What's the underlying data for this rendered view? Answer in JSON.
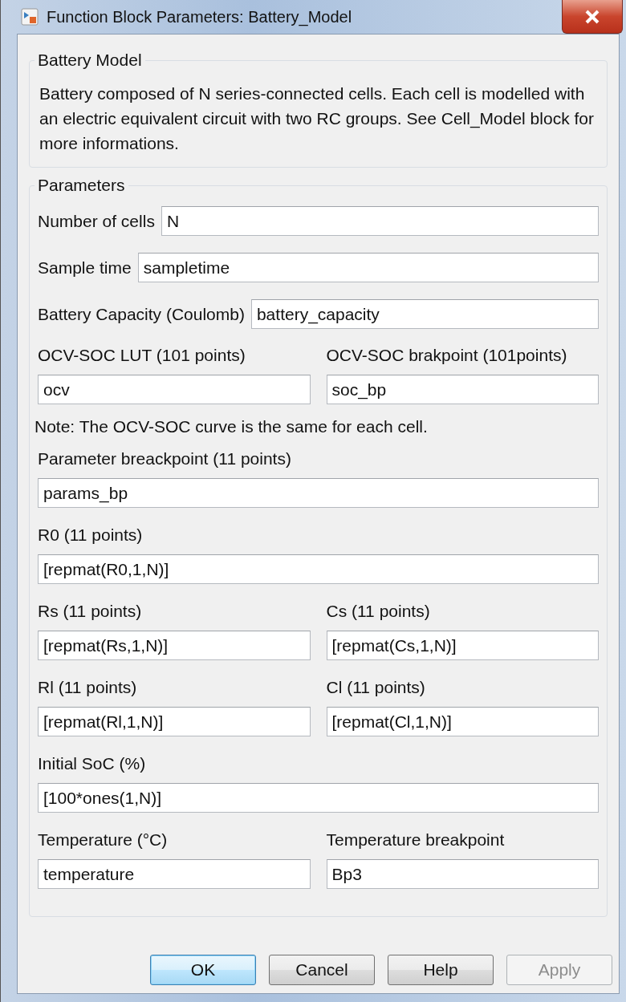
{
  "window": {
    "title": "Function Block Parameters: Battery_Model"
  },
  "description_group": {
    "title": "Battery Model",
    "text": "Battery composed of N series-connected cells. Each cell is modelled with an electric equivalent circuit with two RC groups. See Cell_Model block for more informations."
  },
  "parameters_group": {
    "title": "Parameters",
    "rows": [
      {
        "kind": "inline",
        "fields": [
          {
            "label": "Number of cells",
            "value": "N"
          }
        ]
      },
      {
        "kind": "inline",
        "fields": [
          {
            "label": "Sample time",
            "value": "sampletime"
          }
        ]
      },
      {
        "kind": "inline",
        "fields": [
          {
            "label": "Battery Capacity (Coulomb)",
            "value": "battery_capacity"
          }
        ]
      },
      {
        "kind": "pair",
        "fields": [
          {
            "label": "OCV-SOC LUT (101 points)",
            "value": "ocv"
          },
          {
            "label": "OCV-SOC brakpoint (101points)",
            "value": "soc_bp"
          }
        ]
      },
      {
        "kind": "note",
        "text": "Note: The OCV-SOC curve is the same for each cell."
      },
      {
        "kind": "stacked",
        "fields": [
          {
            "label": "Parameter breackpoint (11 points)",
            "value": "params_bp"
          }
        ]
      },
      {
        "kind": "stacked",
        "fields": [
          {
            "label": "R0 (11 points)",
            "value": "[repmat(R0,1,N)]"
          }
        ]
      },
      {
        "kind": "pair",
        "fields": [
          {
            "label": "Rs (11 points)",
            "value": "[repmat(Rs,1,N)]"
          },
          {
            "label": "Cs (11 points)",
            "value": "[repmat(Cs,1,N)]"
          }
        ]
      },
      {
        "kind": "pair",
        "fields": [
          {
            "label": "Rl (11 points)",
            "value": "[repmat(Rl,1,N)]"
          },
          {
            "label": "Cl (11 points)",
            "value": "[repmat(Cl,1,N)]"
          }
        ]
      },
      {
        "kind": "stacked",
        "fields": [
          {
            "label": "Initial SoC (%)",
            "value": "[100*ones(1,N)]"
          }
        ]
      },
      {
        "kind": "pair",
        "fields": [
          {
            "label": "Temperature (°C)",
            "value": "temperature"
          },
          {
            "label": "Temperature breakpoint",
            "value": "Bp3"
          }
        ]
      }
    ]
  },
  "buttons": [
    {
      "label": "OK",
      "default": true,
      "disabled": false
    },
    {
      "label": "Cancel",
      "default": false,
      "disabled": false
    },
    {
      "label": "Help",
      "default": false,
      "disabled": false
    },
    {
      "label": "Apply",
      "default": false,
      "disabled": true
    }
  ]
}
